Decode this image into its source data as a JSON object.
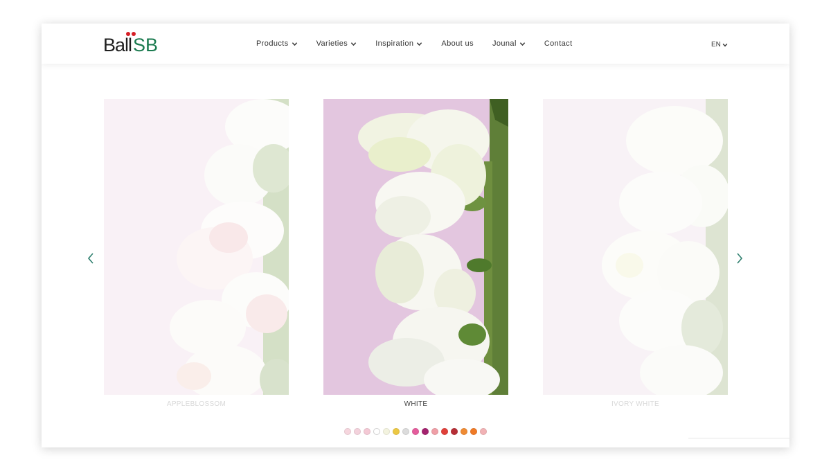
{
  "brand": {
    "logo_left": "Ball",
    "logo_right": "SB"
  },
  "nav": {
    "items": [
      {
        "label": "Products",
        "dropdown": true
      },
      {
        "label": "Varieties",
        "dropdown": true
      },
      {
        "label": "Inspiration",
        "dropdown": true
      },
      {
        "label": "About us",
        "dropdown": false
      },
      {
        "label": "Jounal",
        "dropdown": true
      },
      {
        "label": "Contact",
        "dropdown": false
      }
    ],
    "language": "EN"
  },
  "carousel": {
    "slides": [
      {
        "caption": "APPLEBLOSSOM",
        "state": "faded"
      },
      {
        "caption": "WHITE",
        "state": "active"
      },
      {
        "caption": "IVORY WHITE",
        "state": "faded"
      }
    ],
    "prev_icon": "chevron-left-icon",
    "next_icon": "chevron-right-icon",
    "color_dots": [
      "#f6d6de",
      "#f3d2dc",
      "#f4c9d5",
      "#ffffff",
      "#f3f3df",
      "#ecc844",
      "#dcdcdc",
      "#e45c9c",
      "#a3226e",
      "#ef9fa7",
      "#e0403a",
      "#b62e36",
      "#ef8b34",
      "#ef7a26",
      "#f1b2b5"
    ]
  },
  "colors": {
    "brand_green": "#1a7a4f",
    "brand_red": "#d61f26",
    "accent_arrow": "#2f7f6f"
  }
}
